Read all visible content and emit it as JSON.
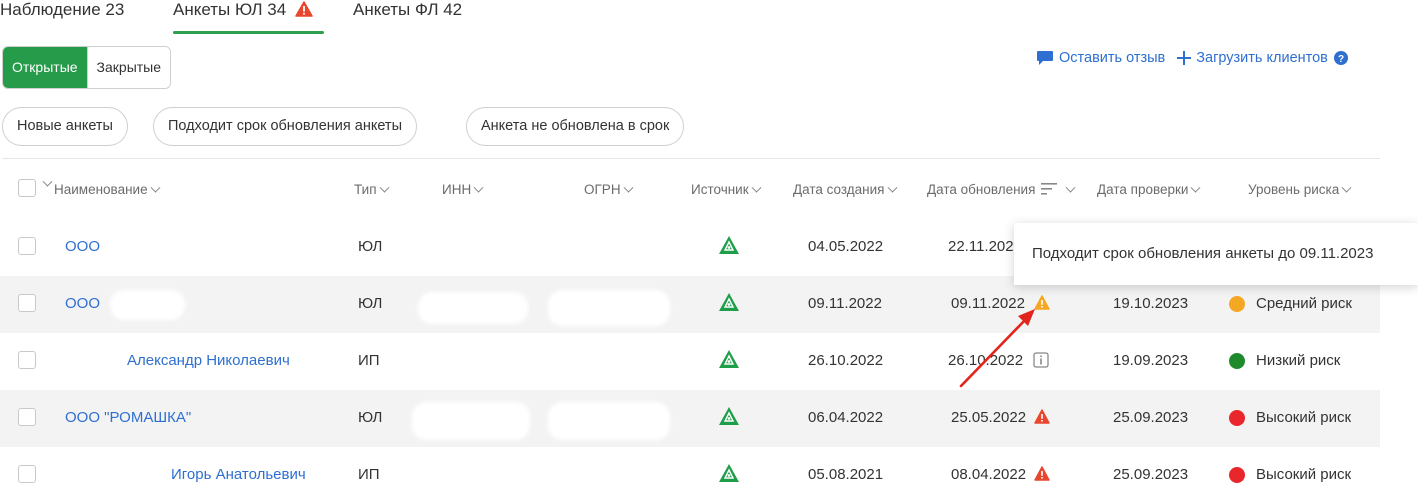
{
  "tabs": [
    {
      "label": "Наблюдение 23"
    },
    {
      "label": "Анкеты ЮЛ 34"
    },
    {
      "label": "Анкеты ФЛ 42"
    }
  ],
  "toggle": {
    "open_label": "Открытые",
    "closed_label": "Закрытые"
  },
  "actions": {
    "feedback_label": "Оставить отзыв",
    "upload_label": "Загрузить клиентов"
  },
  "filters": [
    {
      "label": "Новые анкеты"
    },
    {
      "label": "Подходит срок обновления анкеты"
    },
    {
      "label": "Анкета не обновлена в срок"
    }
  ],
  "table": {
    "columns": {
      "name": "Наименование",
      "type": "Тип",
      "inn": "ИНН",
      "ogrn": "ОГРН",
      "source": "Источник",
      "created": "Дата создания",
      "updated": "Дата обновления",
      "checked": "Дата проверки",
      "risk": "Уровень риска"
    },
    "rows": [
      {
        "name": "ООО",
        "type": "ЮЛ",
        "created": "04.05.2022",
        "updated": "22.11.2022",
        "checked": "",
        "risk": "",
        "risk_color": "",
        "status_icon": "none"
      },
      {
        "name": "ООО",
        "type": "ЮЛ",
        "created": "09.11.2022",
        "updated": "09.11.2022",
        "checked": "19.10.2023",
        "risk": "Средний риск",
        "risk_color": "#f5a623",
        "status_icon": "warning-yellow"
      },
      {
        "name": "Александр Николаевич",
        "type": "ИП",
        "created": "26.10.2022",
        "updated": "26.10.2022",
        "checked": "19.09.2023",
        "risk": "Низкий риск",
        "risk_color": "#1f8a2c",
        "status_icon": "info"
      },
      {
        "name": "ООО \"РОМАШКА\"",
        "type": "ЮЛ",
        "created": "06.04.2022",
        "updated": "25.05.2022",
        "checked": "25.09.2023",
        "risk": "Высокий риск",
        "risk_color": "#e8262b",
        "status_icon": "warning-red"
      },
      {
        "name": "Игорь Анатольевич",
        "type": "ИП",
        "created": "05.08.2021",
        "updated": "08.04.2022",
        "checked": "25.09.2023",
        "risk": "Высокий риск",
        "risk_color": "#e8262b",
        "status_icon": "warning-red"
      }
    ]
  },
  "tooltip": {
    "text": "Подходит срок обновления анкеты до 09.11.2023"
  },
  "colors": {
    "accent_green": "#269b4a",
    "link_blue": "#2e6fd1",
    "warning_red": "#e8472e",
    "warning_yellow": "#f5a623"
  }
}
